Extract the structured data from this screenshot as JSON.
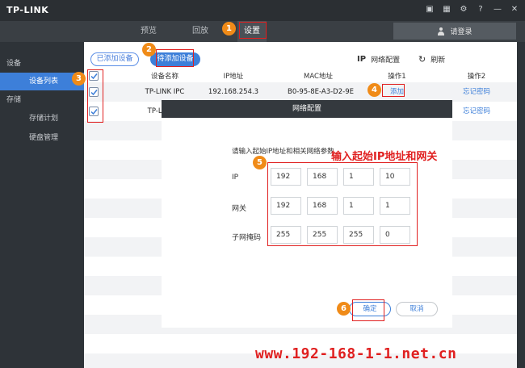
{
  "titlebar": {
    "logo": "TP-LINK"
  },
  "nav": {
    "tabs": [
      "预览",
      "回放",
      "设置"
    ],
    "active": "设置",
    "login": "请登录"
  },
  "sidebar": {
    "groups": [
      {
        "label": "设备",
        "items": [
          "设备列表"
        ]
      },
      {
        "label": "存储",
        "items": [
          "存储计划",
          "硬盘管理"
        ]
      }
    ],
    "active": "设备列表"
  },
  "toolbar": {
    "added_label": "已添加设备",
    "pending_label": "待添加设备",
    "net_config_ip": "IP",
    "net_config_label": "网络配置",
    "refresh_label": "刷新"
  },
  "table": {
    "headers": [
      "设备名称",
      "IP地址",
      "MAC地址",
      "操作1",
      "操作2"
    ],
    "rows": [
      {
        "name": "TP-LINK IPC",
        "ip": "192.168.254.3",
        "mac": "B0-95-8E-A3-D2-9E",
        "op1": "添加",
        "op2": "忘记密码"
      },
      {
        "name": "TP-LINK IP",
        "ip": "",
        "mac": "",
        "op1": "",
        "op2": "忘记密码"
      }
    ]
  },
  "modal": {
    "title": "网络配置",
    "description": "请输入起始IP地址和相关网络参数",
    "fields": [
      {
        "label": "IP",
        "octets": [
          "192",
          "168",
          "1",
          "10"
        ]
      },
      {
        "label": "网关",
        "octets": [
          "192",
          "168",
          "1",
          "1"
        ]
      },
      {
        "label": "子网掩码",
        "octets": [
          "255",
          "255",
          "255",
          "0"
        ]
      }
    ],
    "ok_label": "确定",
    "cancel_label": "取消"
  },
  "annotations": {
    "badges": [
      "1",
      "2",
      "3",
      "4",
      "5",
      "6"
    ],
    "hint": "输入起始IP地址和网关",
    "watermark": "www.192-168-1-1.net.cn"
  },
  "colors": {
    "accent": "#3d7fd9",
    "annotation": "#e02020",
    "badge": "#f08b18"
  }
}
